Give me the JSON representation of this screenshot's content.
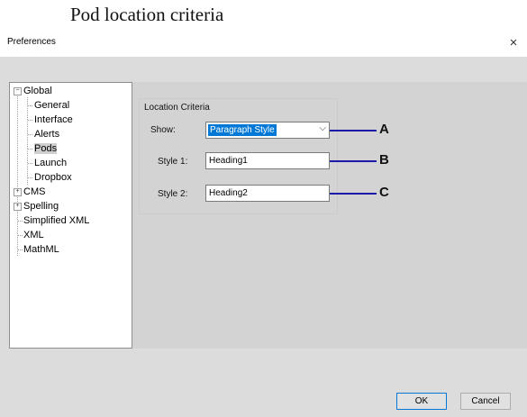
{
  "caption": "Pod location criteria",
  "window": {
    "title": "Preferences",
    "close_glyph": "×"
  },
  "tree": {
    "global": "Global",
    "general": "General",
    "interface": "Interface",
    "alerts": "Alerts",
    "pods": "Pods",
    "launch": "Launch",
    "dropbox": "Dropbox",
    "cms": "CMS",
    "spelling": "Spelling",
    "simplified_xml": "Simplified XML",
    "xml": "XML",
    "mathml": "MathML",
    "expanded_glyph": "−",
    "collapsed_glyph": "+",
    "selected": "Pods"
  },
  "panel": {
    "group_label": "Location Criteria",
    "show_label": "Show:",
    "show_value": "Paragraph Style",
    "dropdown_glyph": "⌵",
    "style1_label": "Style 1:",
    "style1_value": "Heading1",
    "style2_label": "Style 2:",
    "style2_value": "Heading2"
  },
  "callouts": {
    "a": "A",
    "b": "B",
    "c": "C",
    "line_color": "#1a1aa6"
  },
  "buttons": {
    "ok": "OK",
    "cancel": "Cancel"
  },
  "colors": {
    "selection": "#0078d7",
    "client_bg": "#dcdcdc"
  }
}
